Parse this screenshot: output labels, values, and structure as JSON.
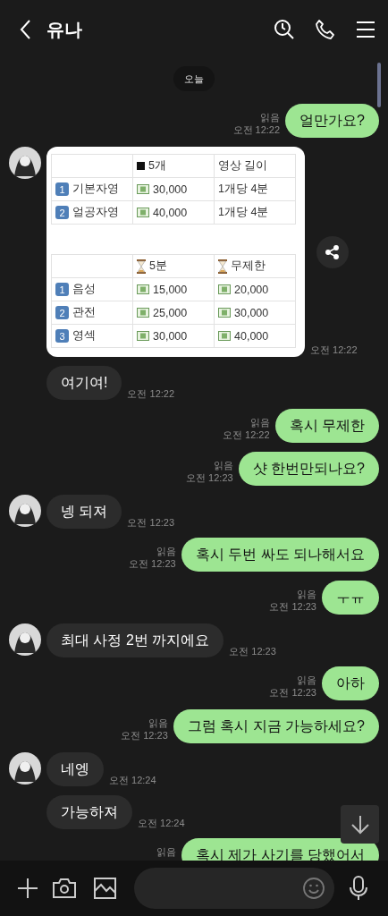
{
  "header": {
    "title": "유나"
  },
  "date_divider": "오늘",
  "messages": [
    {
      "kind": "sent",
      "text": "얼만가요?",
      "read": "읽음",
      "time": "오전 12:22"
    },
    {
      "kind": "image",
      "avatar": true,
      "time": "오전 12:22",
      "tables": [
        {
          "columns": [
            {
              "text": "5개",
              "kind": "count"
            },
            {
              "text": "영상 길이",
              "kind": "plain"
            }
          ],
          "rows": [
            {
              "badge": "1",
              "label": "기본자영",
              "cells": [
                {
                  "text": "30,000",
                  "kind": "price"
                },
                {
                  "text": "1개당 4분",
                  "kind": "plain"
                }
              ]
            },
            {
              "badge": "2",
              "label": "얼공자영",
              "cells": [
                {
                  "text": "40,000",
                  "kind": "price"
                },
                {
                  "text": "1개당 4분",
                  "kind": "plain"
                }
              ]
            }
          ]
        },
        {
          "columns": [
            {
              "text": "5분",
              "kind": "duration"
            },
            {
              "text": "무제한",
              "kind": "duration"
            }
          ],
          "rows": [
            {
              "badge": "1",
              "label": "음성",
              "cells": [
                {
                  "text": "15,000",
                  "kind": "price"
                },
                {
                  "text": "20,000",
                  "kind": "price"
                }
              ]
            },
            {
              "badge": "2",
              "label": "관전",
              "cells": [
                {
                  "text": "25,000",
                  "kind": "price"
                },
                {
                  "text": "30,000",
                  "kind": "price"
                }
              ]
            },
            {
              "badge": "3",
              "label": "영섹",
              "cells": [
                {
                  "text": "30,000",
                  "kind": "price"
                },
                {
                  "text": "40,000",
                  "kind": "price"
                }
              ]
            }
          ]
        }
      ]
    },
    {
      "kind": "received",
      "avatar": false,
      "text": "여기여!",
      "time": "오전 12:22"
    },
    {
      "kind": "sent",
      "text": "혹시 무제한",
      "read": "읽음",
      "time": "오전 12:22"
    },
    {
      "kind": "sent",
      "text": "샷 한번만되나요?",
      "read": "읽음",
      "time": "오전 12:23"
    },
    {
      "kind": "received",
      "avatar": true,
      "text": "넹 되져",
      "time": "오전 12:23"
    },
    {
      "kind": "sent",
      "text": "혹시 두번 싸도 되나해서요",
      "read": "읽음",
      "time": "오전 12:23"
    },
    {
      "kind": "sent",
      "text": "ㅜㅠ",
      "read": "읽음",
      "time": "오전 12:23"
    },
    {
      "kind": "received",
      "avatar": true,
      "text": "최대 사정 2번 까지에요",
      "time": "오전 12:23"
    },
    {
      "kind": "sent",
      "text": "아하",
      "read": "읽음",
      "time": "오전 12:23"
    },
    {
      "kind": "sent",
      "text": "그럼 혹시 지금 가능하세요?",
      "read": "읽음",
      "time": "오전 12:23"
    },
    {
      "kind": "received",
      "avatar": true,
      "text": "네엥",
      "time": "오전 12:24"
    },
    {
      "kind": "received",
      "avatar": false,
      "text": "가능하져",
      "time": "오전 12:24"
    },
    {
      "kind": "sent",
      "text": "혹시 제가 사기를 당했어서",
      "read": "읽음"
    }
  ]
}
